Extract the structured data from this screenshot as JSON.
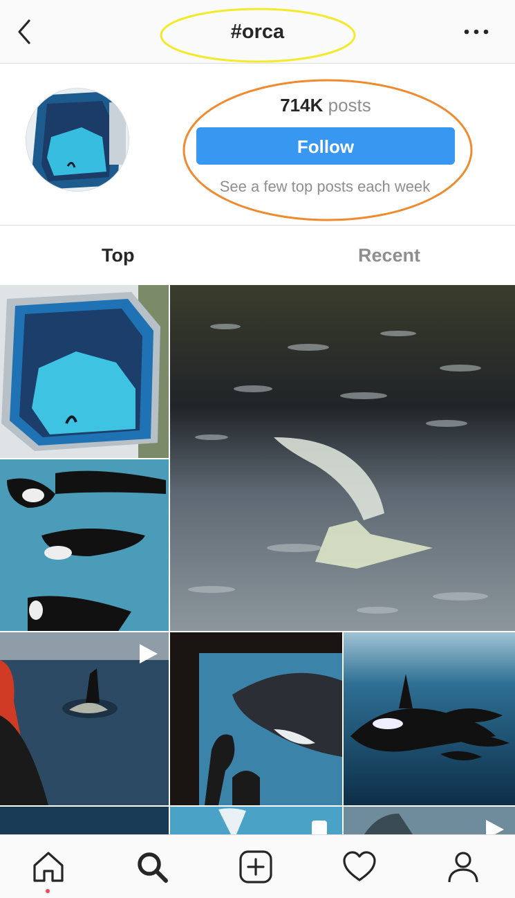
{
  "header": {
    "title": "#orca",
    "back_icon": "chevron-left-icon",
    "more_icon": "ellipsis-icon"
  },
  "profile": {
    "posts_count": "714K",
    "posts_label": "posts",
    "follow_label": "Follow",
    "subnote": "See a few top posts each week"
  },
  "tabs": {
    "top": "Top",
    "recent": "Recent"
  },
  "annotation_colors": {
    "yellow": "#f2ea2a",
    "orange": "#f08a2e"
  },
  "brand": {
    "follow_blue": "#3897f0",
    "notification_red": "#ed4956"
  },
  "grid": {
    "tiles": [
      {
        "name": "aerial-pool",
        "video": false
      },
      {
        "name": "water-reflection-orca",
        "video": false
      },
      {
        "name": "orcas-in-tank",
        "video": false
      },
      {
        "name": "orca-surfacing-boat",
        "video": true
      },
      {
        "name": "orca-aquarium-window",
        "video": false
      },
      {
        "name": "orca-pod-underwater",
        "video": false
      },
      {
        "name": "partial-tile-1",
        "video": false
      },
      {
        "name": "partial-tile-2",
        "video": true
      },
      {
        "name": "partial-tile-3",
        "video": true
      }
    ]
  },
  "bottom_nav": {
    "items": [
      "home-icon",
      "search-icon",
      "add-post-icon",
      "heart-icon",
      "profile-icon"
    ]
  }
}
